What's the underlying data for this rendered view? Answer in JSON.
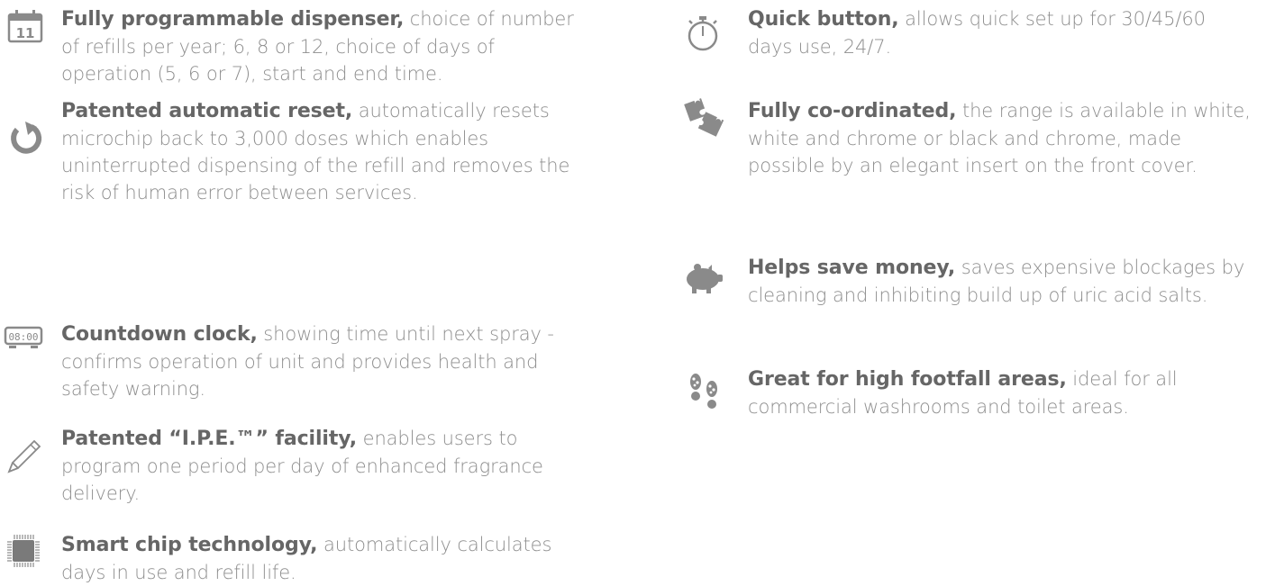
{
  "features_left": [
    {
      "icon": "calendar-icon",
      "icon_text": "11",
      "lead": "Fully programmable dispenser,",
      "body": " choice of number of refills per year; 6, 8 or 12, choice of days of operation (5, 6 or 7), start and end time."
    },
    {
      "icon": "reset-arrow-icon",
      "lead": "Patented automatic reset,",
      "body": " automatically resets microchip back to 3,000 doses which enables uninterrupted dispensing of the refill and removes the risk of human error between services."
    },
    {
      "icon": "digital-clock-icon",
      "icon_text": "08:00",
      "lead": "Countdown clock,",
      "body": " showing time until next spray - confirms operation of unit and provides health and safety warning."
    },
    {
      "icon": "pencil-icon",
      "lead": "Patented “I.P.E.™” facility,",
      "body": " enables users to program one period per day of enhanced fragrance delivery."
    },
    {
      "icon": "microchip-icon",
      "lead": "Smart chip technology,",
      "body": " automatically calculates days in use and refill life."
    }
  ],
  "features_right": [
    {
      "icon": "stopwatch-icon",
      "lead": "Quick button,",
      "body": " allows quick set up for 30/45/60 days use, 24/7."
    },
    {
      "icon": "puzzle-icon",
      "lead": "Fully co-ordinated,",
      "body": " the range is available in white, white and chrome or black and chrome, made possible by an elegant insert on the front cover."
    },
    {
      "icon": "piggy-bank-icon",
      "lead": "Helps save money,",
      "body": " saves expensive blockages by cleaning and inhibiting build up of uric acid salts."
    },
    {
      "icon": "footprints-icon",
      "lead": "Great for high footfall areas,",
      "body": " ideal for all commercial washrooms and toilet areas."
    }
  ],
  "colors": {
    "text": "#8e8e8e",
    "lead": "#666666",
    "icon": "#8a8a8a"
  }
}
